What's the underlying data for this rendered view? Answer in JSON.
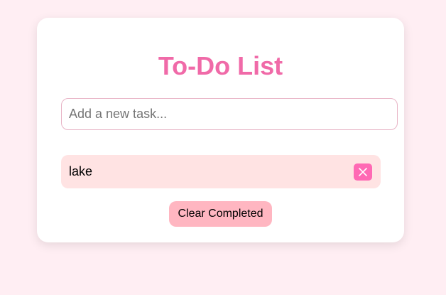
{
  "app": {
    "title": "To-Do List"
  },
  "input": {
    "value": "",
    "placeholder": "Add a new task..."
  },
  "tasks": [
    {
      "text": "lake",
      "completed": false
    }
  ],
  "actions": {
    "clear_label": "Clear Completed"
  },
  "icons": {
    "delete": "close-icon"
  },
  "colors": {
    "background": "#ffeef3",
    "title": "#f06aa8",
    "task_bg": "#ffe3e3",
    "delete_bg": "#ff69b4",
    "clear_bg": "#ffb6c1"
  }
}
